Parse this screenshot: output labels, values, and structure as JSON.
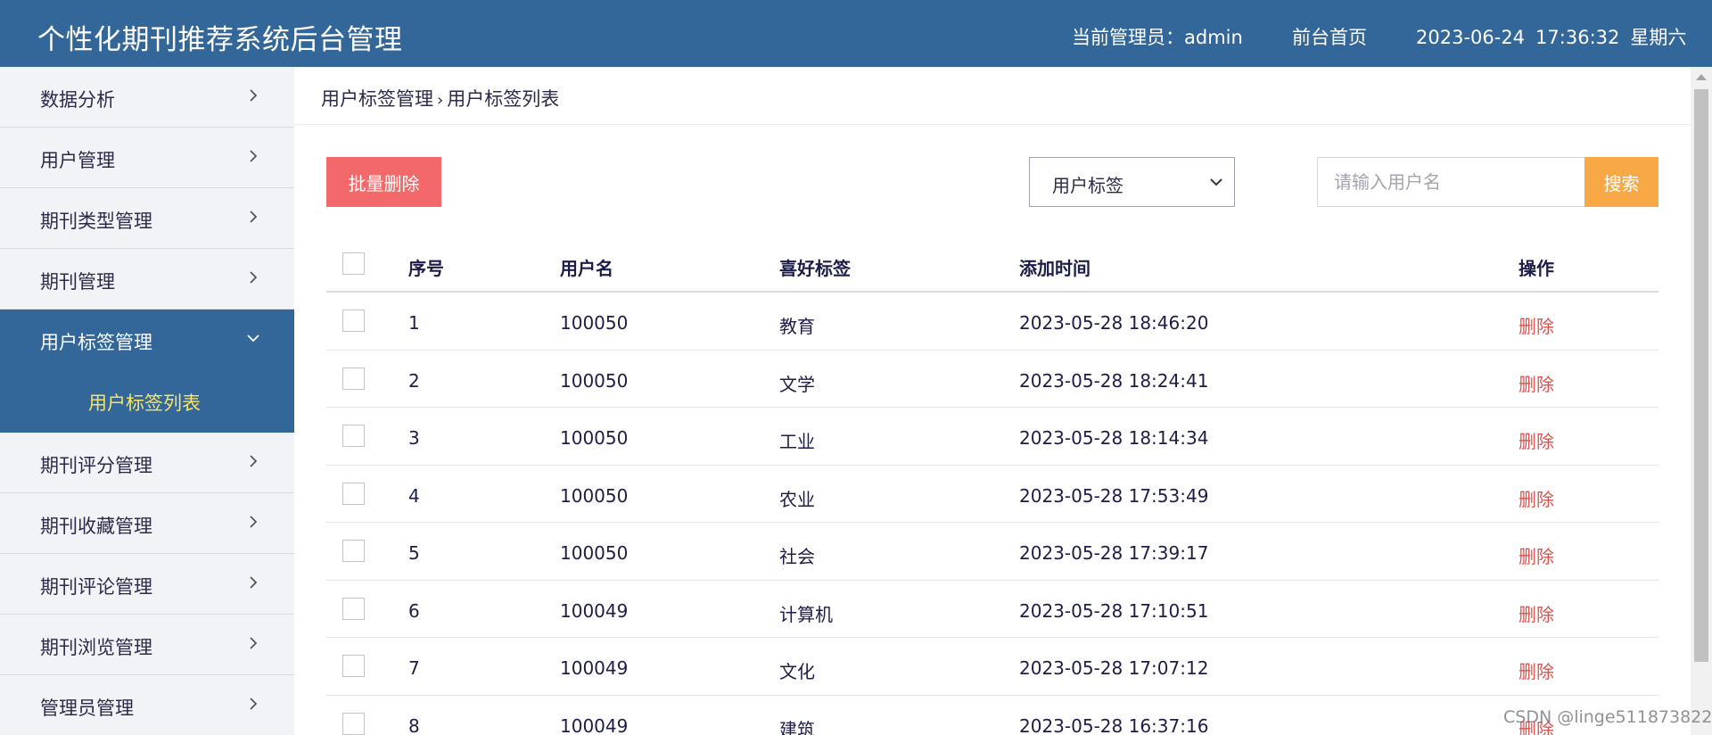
{
  "header": {
    "title": "个性化期刊推荐系统后台管理",
    "admin_info": "当前管理员：admin",
    "front_link": "前台首页",
    "date": "2023-06-24",
    "time": "17:36:32",
    "weekday": "星期六"
  },
  "sidebar": {
    "items": [
      {
        "label": "数据分析"
      },
      {
        "label": "用户管理"
      },
      {
        "label": "期刊类型管理"
      },
      {
        "label": "期刊管理"
      },
      {
        "label": "用户标签管理",
        "active": true
      },
      {
        "label": "期刊评分管理"
      },
      {
        "label": "期刊收藏管理"
      },
      {
        "label": "期刊评论管理"
      },
      {
        "label": "期刊浏览管理"
      },
      {
        "label": "管理员管理"
      }
    ],
    "active_submenu": "用户标签列表"
  },
  "breadcrumb": {
    "parent": "用户标签管理",
    "current": "用户标签列表"
  },
  "toolbar": {
    "batch_delete": "批量删除",
    "select_value": "用户标签",
    "search_placeholder": "请输入用户名",
    "search_button": "搜索"
  },
  "table": {
    "columns": [
      "序号",
      "用户名",
      "喜好标签",
      "添加时间",
      "操作"
    ],
    "rows": [
      {
        "seq": "1",
        "user": "100050",
        "tag": "教育",
        "time": "2023-05-28 18:46:20",
        "op": "删除"
      },
      {
        "seq": "2",
        "user": "100050",
        "tag": "文学",
        "time": "2023-05-28 18:24:41",
        "op": "删除"
      },
      {
        "seq": "3",
        "user": "100050",
        "tag": "工业",
        "time": "2023-05-28 18:14:34",
        "op": "删除"
      },
      {
        "seq": "4",
        "user": "100050",
        "tag": "农业",
        "time": "2023-05-28 17:53:49",
        "op": "删除"
      },
      {
        "seq": "5",
        "user": "100050",
        "tag": "社会",
        "time": "2023-05-28 17:39:17",
        "op": "删除"
      },
      {
        "seq": "6",
        "user": "100049",
        "tag": "计算机",
        "time": "2023-05-28 17:10:51",
        "op": "删除"
      },
      {
        "seq": "7",
        "user": "100049",
        "tag": "文化",
        "time": "2023-05-28 17:07:12",
        "op": "删除"
      },
      {
        "seq": "8",
        "user": "100049",
        "tag": "建筑",
        "time": "2023-05-28 16:37:16",
        "op": "删除"
      }
    ]
  },
  "watermark": "CSDN @linge511873822",
  "colors": {
    "header_bg": "#336699",
    "submenu_text": "#f7e46a",
    "batch_delete_bg": "#f36868",
    "search_button_bg": "#f8a945",
    "delete_link": "#d9534f"
  },
  "icons": {
    "menu_arrow": "chevron-right-icon",
    "menu_expanded": "chevron-down-icon",
    "select_arrow": "chevron-down-icon"
  }
}
